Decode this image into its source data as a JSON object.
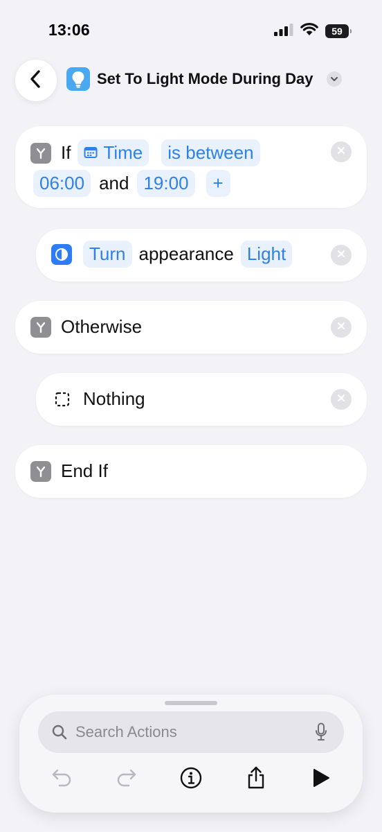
{
  "status_bar": {
    "time": "13:06",
    "battery": "59"
  },
  "header": {
    "title": "Set To Light Mode During Day"
  },
  "actions": {
    "if_block": {
      "keyword": "If",
      "variable": "Time",
      "condition": "is between",
      "start": "06:00",
      "connector": "and",
      "end": "19:00",
      "add": "+"
    },
    "appearance": {
      "verb": "Turn",
      "noun": "appearance",
      "value": "Light"
    },
    "otherwise": {
      "label": "Otherwise"
    },
    "nothing": {
      "label": "Nothing"
    },
    "end_if": {
      "label": "End If"
    }
  },
  "bottom": {
    "search_placeholder": "Search Actions"
  },
  "colors": {
    "accent": "#2f80e8",
    "token_bg": "#e9f1fc",
    "control_icon": "#8e8e93",
    "background": "#f2f2f7"
  },
  "icons": {
    "back": "chevron-left-icon",
    "app": "lightbulb-icon",
    "control": "branch-icon",
    "calendar": "calendar-icon",
    "appearance": "appearance-icon",
    "nothing": "dashed-square-icon",
    "close": "close-icon",
    "search": "search-icon",
    "mic": "microphone-icon",
    "undo": "undo-icon",
    "redo": "redo-icon",
    "info": "info-icon",
    "share": "share-icon",
    "play": "play-icon"
  }
}
